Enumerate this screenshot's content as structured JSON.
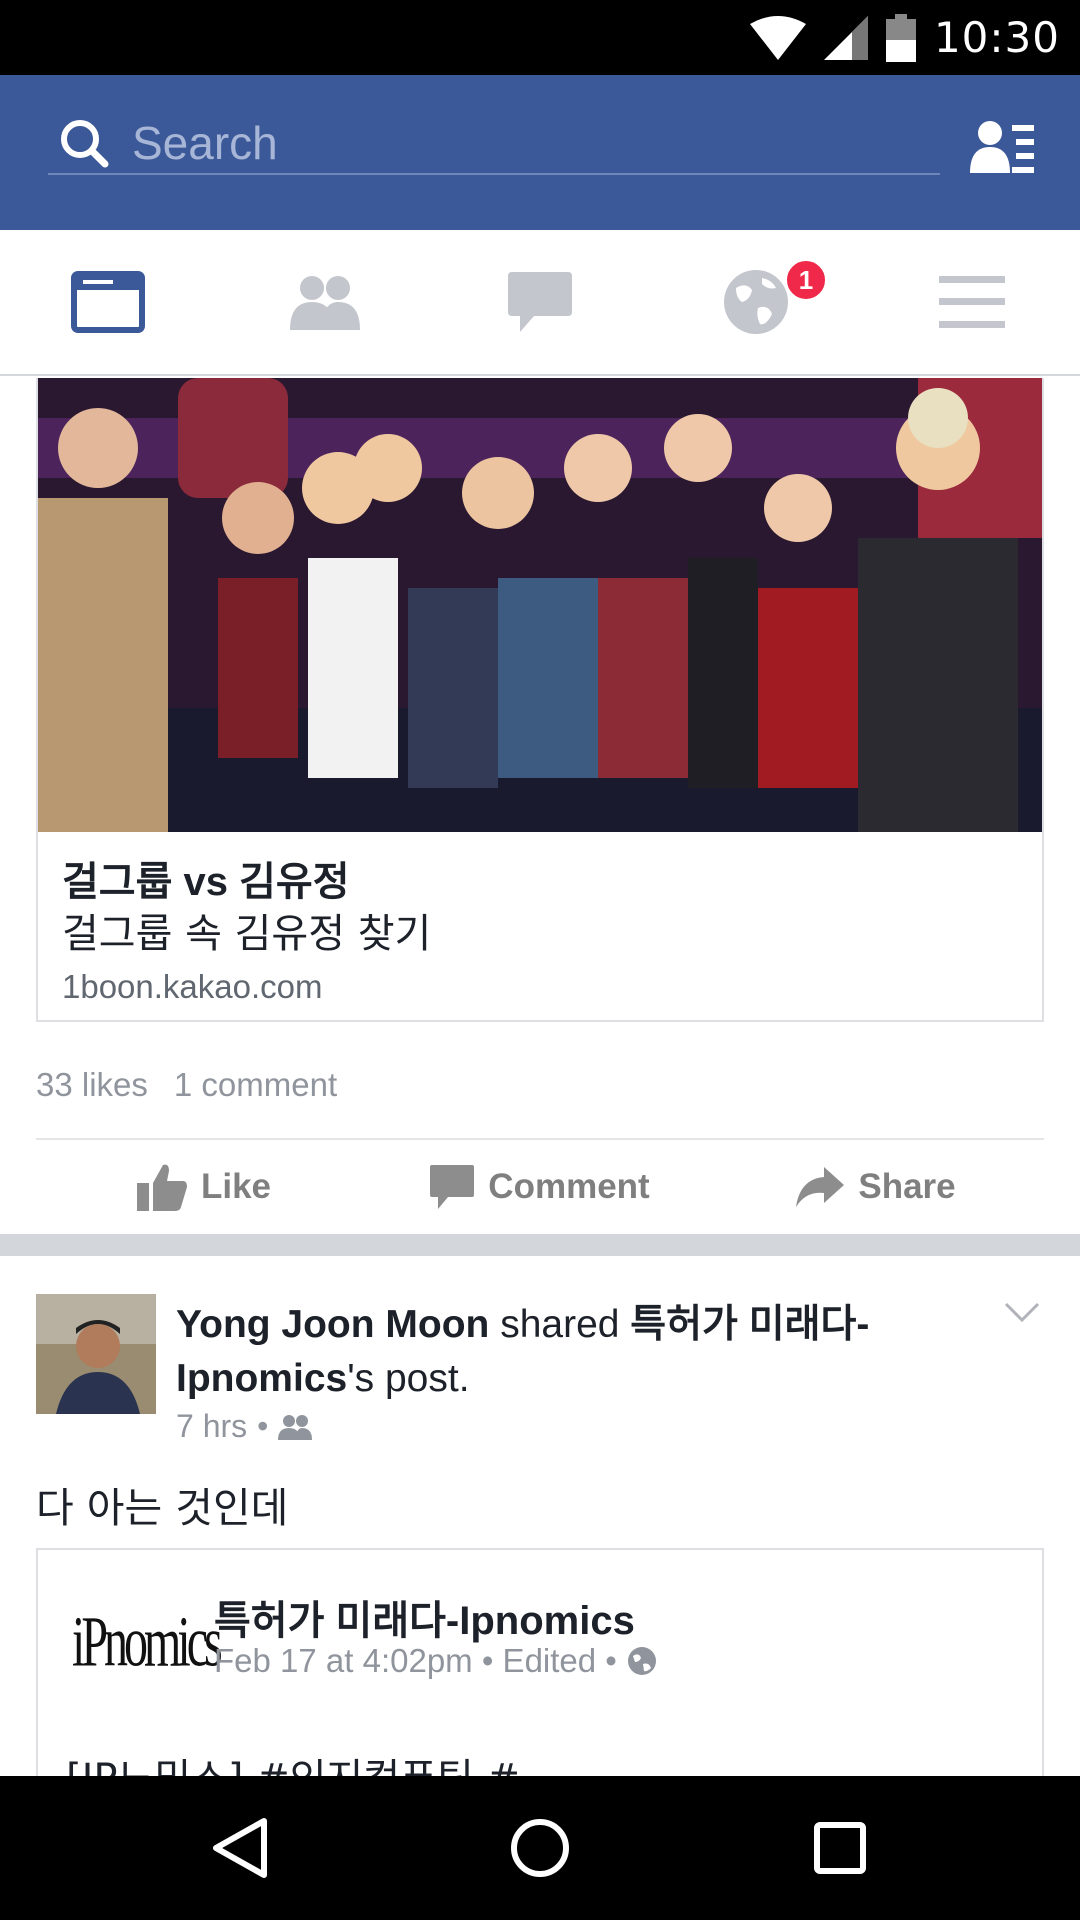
{
  "status_bar": {
    "time": "10:30",
    "icons": [
      "wifi-icon",
      "cell-signal-icon",
      "battery-icon"
    ]
  },
  "search": {
    "placeholder": "Search"
  },
  "tabs": [
    {
      "name": "news-feed",
      "icon": "news-feed-icon",
      "active": true
    },
    {
      "name": "friends",
      "icon": "friends-icon",
      "active": false
    },
    {
      "name": "messages",
      "icon": "messages-icon",
      "active": false
    },
    {
      "name": "notifications",
      "icon": "globe-icon",
      "active": false,
      "badge": "1"
    },
    {
      "name": "more",
      "icon": "menu-icon",
      "active": false
    }
  ],
  "link_post": {
    "title": "걸그룹 vs 김유정",
    "description": "걸그룹 속 김유정 찾기",
    "domain": "1boon.kakao.com",
    "likes": "33 likes",
    "comments": "1 comment",
    "actions": {
      "like": "Like",
      "comment": "Comment",
      "share": "Share"
    }
  },
  "shared_post": {
    "author": "Yong Joon Moon",
    "shared_word": " shared ",
    "page_name": "특허가 미래다-Ipnomics",
    "possessive": "'s post.",
    "time": "7 hrs",
    "separator": "•",
    "text": "다 아는 것인데",
    "inner": {
      "page_name": "특허가 미래다-Ipnomics",
      "time": "Feb 17 at 4:02pm • Edited •",
      "logo_text": "iPnomics",
      "text": "[IP노믹스] #인지컴퓨팅 #"
    }
  },
  "colors": {
    "brand_blue": "#3b5998",
    "badge_red": "#f02849",
    "muted": "#90949c"
  }
}
